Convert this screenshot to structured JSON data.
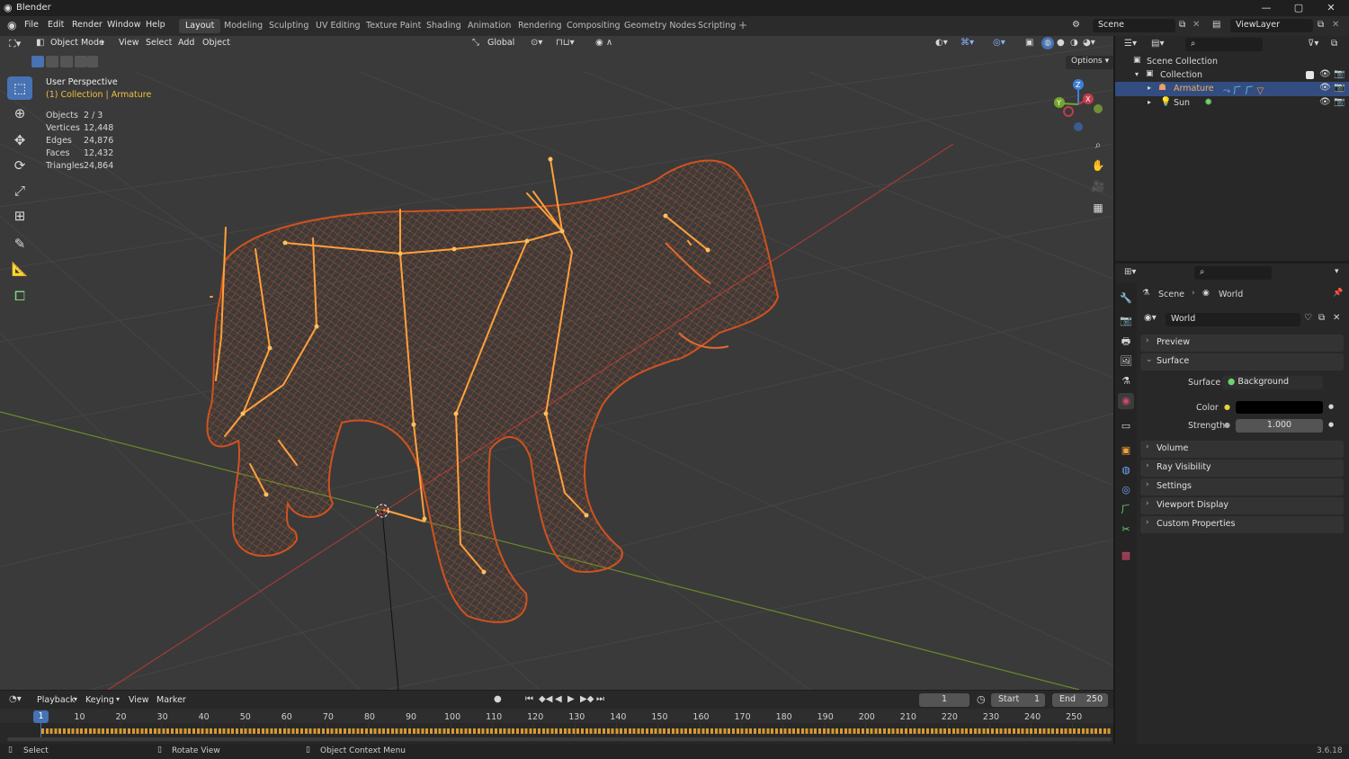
{
  "app": {
    "title": "Blender",
    "version": "3.6.18"
  },
  "menu": [
    "File",
    "Edit",
    "Render",
    "Window",
    "Help"
  ],
  "workspaces": [
    "Layout",
    "Modeling",
    "Sculpting",
    "UV Editing",
    "Texture Paint",
    "Shading",
    "Animation",
    "Rendering",
    "Compositing",
    "Geometry Nodes",
    "Scripting"
  ],
  "scene": {
    "name": "Scene",
    "view_layer": "ViewLayer"
  },
  "viewport": {
    "mode": "Object Mode",
    "menus": [
      "View",
      "Select",
      "Add",
      "Object"
    ],
    "transform": "Global",
    "options": "Options",
    "perspective": "User Perspective",
    "context": "(1) Collection | Armature",
    "stats": [
      {
        "label": "Objects",
        "value": "2 / 3"
      },
      {
        "label": "Vertices",
        "value": "12,448"
      },
      {
        "label": "Edges",
        "value": "24,876"
      },
      {
        "label": "Faces",
        "value": "12,432"
      },
      {
        "label": "Triangles",
        "value": "24,864"
      }
    ],
    "gizmo": {
      "x": "X",
      "y": "Y",
      "z": "Z"
    }
  },
  "outliner": {
    "root": "Scene Collection",
    "collection": "Collection",
    "items": [
      {
        "name": "Armature",
        "selected": true
      },
      {
        "name": "Sun",
        "selected": false
      }
    ]
  },
  "properties": {
    "breadcrumb": [
      "Scene",
      "World"
    ],
    "world_name": "World",
    "panels": [
      "Preview",
      "Surface",
      "Volume",
      "Ray Visibility",
      "Settings",
      "Viewport Display",
      "Custom Properties"
    ],
    "surface": {
      "label": "Surface",
      "value": "Background"
    },
    "color": {
      "label": "Color",
      "value": "#000000"
    },
    "strength": {
      "label": "Strength",
      "value": "1.000"
    }
  },
  "timeline": {
    "menus": [
      "Playback",
      "Keying",
      "View",
      "Marker"
    ],
    "current_frame": "1",
    "start_label": "Start",
    "start": "1",
    "end_label": "End",
    "end": "250",
    "ticks": [
      "1",
      "10",
      "20",
      "30",
      "40",
      "50",
      "60",
      "70",
      "80",
      "90",
      "100",
      "110",
      "120",
      "130",
      "140",
      "150",
      "160",
      "170",
      "180",
      "190",
      "200",
      "210",
      "220",
      "230",
      "240",
      "250"
    ]
  },
  "status": [
    {
      "icon": "mouse-left-icon",
      "text": "Select"
    },
    {
      "icon": "mouse-middle-icon",
      "text": "Rotate View"
    },
    {
      "icon": "mouse-right-icon",
      "text": "Object Context Menu"
    }
  ],
  "colors": {
    "accent": "#4772b3",
    "wire": "#d9541e",
    "bone": "#ffa03c",
    "x_axis": "#a33a3a",
    "y_axis": "#6a8a2a"
  }
}
